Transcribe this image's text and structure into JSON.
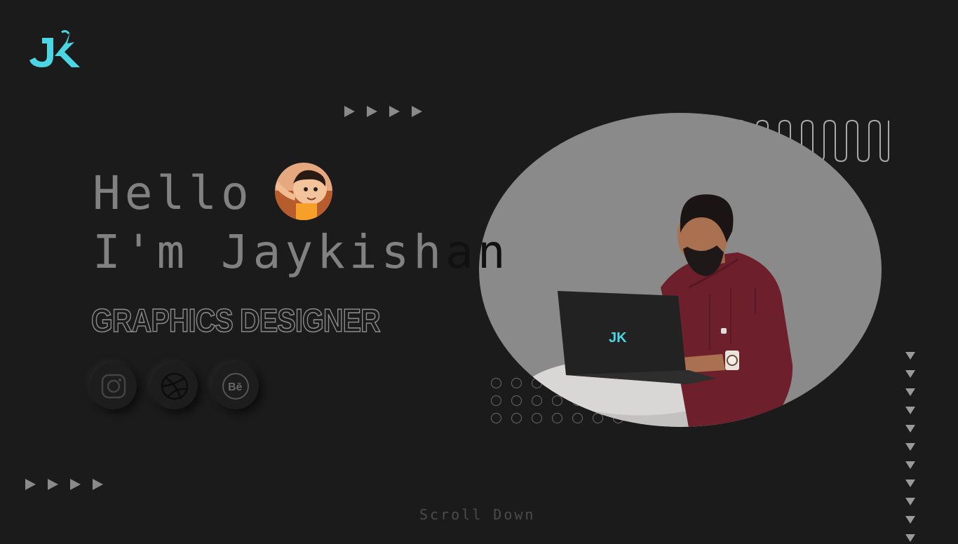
{
  "brand": {
    "logo_text": "JK",
    "accent": "#4cd6e3"
  },
  "hero": {
    "greeting": "Hello",
    "name_prefix": "I'm Jaykish",
    "name_suffix": "an",
    "role": "GRAPHICS DESIGNER"
  },
  "social": [
    {
      "name": "instagram",
      "icon": "instagram-icon"
    },
    {
      "name": "dribbble",
      "icon": "dribbble-icon"
    },
    {
      "name": "behance",
      "icon": "behance-icon",
      "label": "Bē"
    }
  ],
  "scroll_hint": "Scroll Down",
  "illustration": {
    "laptop_logo": "JK"
  },
  "colors": {
    "background": "#1b1b1c",
    "muted_text": "#818181",
    "circle_bg": "#8a8a8a",
    "sweater": "#6e1f2c"
  }
}
